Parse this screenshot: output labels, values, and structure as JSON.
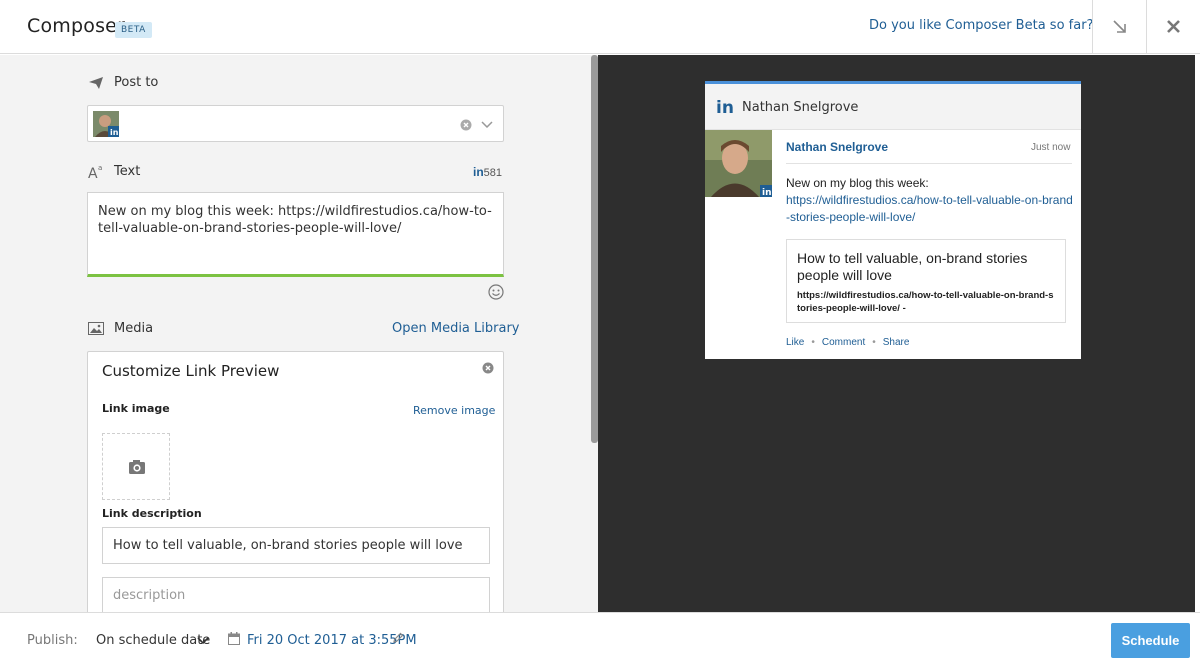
{
  "header": {
    "title": "Composer",
    "badge": "BETA",
    "feedback_link": "Do you like Composer Beta so far?"
  },
  "form": {
    "post_to_label": "Post to",
    "text_label": "Text",
    "char_count": "581",
    "text_value": "New on my blog this week: https://wildfirestudios.ca/how-to-tell-valuable-on-brand-stories-people-will-love/",
    "media_label": "Media",
    "media_library_link": "Open Media Library",
    "link_preview": {
      "title": "Customize Link Preview",
      "image_label": "Link image",
      "remove_image": "Remove image",
      "description_label": "Link description",
      "description_value": "How to tell valuable, on-brand stories people will love",
      "description_placeholder": "description"
    }
  },
  "preview": {
    "header_name": "Nathan Snelgrove",
    "author": "Nathan Snelgrove",
    "time": "Just now",
    "body_text": "New on my blog this week:",
    "body_link": "https://wildfirestudios.ca/how-to-tell-valuable-on-brand-stories-people-will-love/",
    "link_title": "How to tell valuable, on-brand stories people will love",
    "link_url": "https://wildfirestudios.ca/how-to-tell-valuable-on-brand-stories-people-will-love/ -",
    "actions": {
      "like": "Like",
      "comment": "Comment",
      "share": "Share"
    }
  },
  "footer": {
    "publish_label": "Publish:",
    "schedule_mode": "On schedule date",
    "schedule_date": "Fri 20 Oct 2017 at 3:55PM",
    "schedule_button": "Schedule"
  },
  "colors": {
    "accent": "#1f5e94",
    "text_bar": "#7cc242",
    "schedule_button": "#4a9fe0",
    "preview_bg": "#2e2e2e"
  }
}
